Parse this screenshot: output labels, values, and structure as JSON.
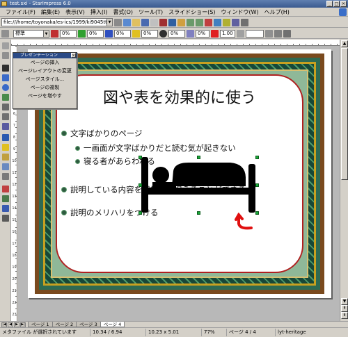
{
  "window": {
    "title": "test.sxi - StarImpress 6.0"
  },
  "menubar": {
    "items": [
      "ファイル(F)",
      "編集(E)",
      "表示(V)",
      "挿入(I)",
      "書式(O)",
      "ツール(T)",
      "スライドショー(S)",
      "ウィンドウ(W)",
      "ヘルプ(H)"
    ]
  },
  "toolbar": {
    "url": "file:///home/toyonaka/es-ics/1999/ki9045tt/test_",
    "line_style": "標準",
    "fields": [
      "0%",
      "0%",
      "0%",
      "0%",
      "0%",
      "0%",
      "1.00"
    ]
  },
  "presentation_panel": {
    "title": "プレゼンテーション",
    "items": [
      "ページの挿入",
      "ページレイアウトの変更",
      "ページスタイル...",
      "ページの複製",
      "ページを増やす"
    ]
  },
  "slide": {
    "title": "図や表を効果的に使う",
    "bullets": [
      {
        "text": "文字ばかりのページ",
        "level": 1
      },
      {
        "text": "一画面が文字ばかりだと読む気が起きない",
        "level": 2
      },
      {
        "text": "寝る者があらわれる",
        "level": 2
      },
      {
        "text": "説明している内容を視覚的に捉えることができる",
        "level": 1
      },
      {
        "text": "説明のメリハリをつける",
        "level": 1
      }
    ]
  },
  "ruler": {
    "vertical_labels": [
      "1",
      "2",
      "3",
      "4",
      "5",
      "6",
      "7",
      "8",
      "9",
      "10",
      "11",
      "12",
      "13",
      "14",
      "15",
      "16",
      "17",
      "18",
      "19",
      "20",
      "21",
      "22",
      "23"
    ]
  },
  "tabs": {
    "items": [
      "ページ 1",
      "ページ 2",
      "ページ 3",
      "ページ 4"
    ],
    "active_index": 3
  },
  "status": {
    "message": "メタファイル が選択されています",
    "position": "10.34 / 6.94",
    "size": "10.23 x 5.01",
    "zoom": "77%",
    "page": "ページ 4 / 4",
    "layout": "lyt-heritage"
  },
  "colors": {
    "frame_brown": "#7a4a1e",
    "frame_green": "#2e6a52",
    "frame_gold": "#c8a020",
    "inner_border_red": "#b02020",
    "selection_handle": "#1aaa3a",
    "cursor_red": "#e01010"
  }
}
